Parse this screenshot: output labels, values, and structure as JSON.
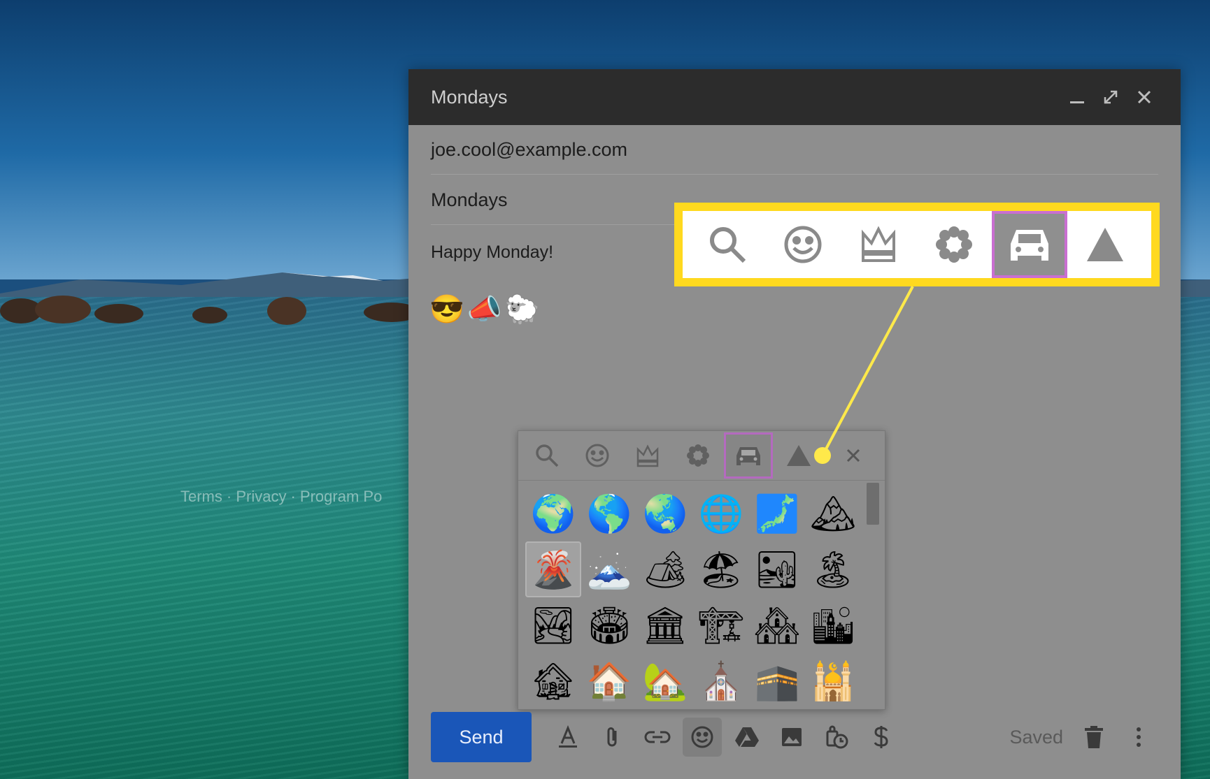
{
  "footer": {
    "links": [
      "Terms",
      "Privacy",
      "Program Po"
    ]
  },
  "compose": {
    "title": "Mondays",
    "to": "joe.cool@example.com",
    "subject": "Mondays",
    "body": "Happy Monday!",
    "body_emojis": "😎📣🐑",
    "window_controls": [
      "minimize-icon",
      "expand-icon",
      "close-icon"
    ]
  },
  "emoji_picker": {
    "tabs": [
      "search-icon",
      "smiley-icon",
      "crown-icon",
      "flower-icon",
      "car-icon",
      "triangle-icon"
    ],
    "selected_tab": "car-icon",
    "emojis": [
      "🌍",
      "🌎",
      "🌏",
      "🌐",
      "🗾",
      "🏔",
      "🌋",
      "🗻",
      "🏕",
      "🏖",
      "🏜",
      "🏝",
      "🏞",
      "🏟",
      "🏛",
      "🏗",
      "🏘",
      "🏙",
      "🏚",
      "🏠",
      "🏡",
      "⛪",
      "🕋",
      "🕌"
    ],
    "highlighted": "🌋"
  },
  "toolbar": {
    "send_label": "Send",
    "saved_label": "Saved",
    "icons": [
      "format-text-icon",
      "attach-icon",
      "link-icon",
      "emoji-icon",
      "drive-icon",
      "image-icon",
      "schedule-icon",
      "dollar-icon"
    ],
    "active_icon": "emoji-icon"
  },
  "colors": {
    "highlight_yellow": "#ffd91f",
    "selected_purple": "#c96fd1",
    "send_blue": "#1a56b8"
  }
}
